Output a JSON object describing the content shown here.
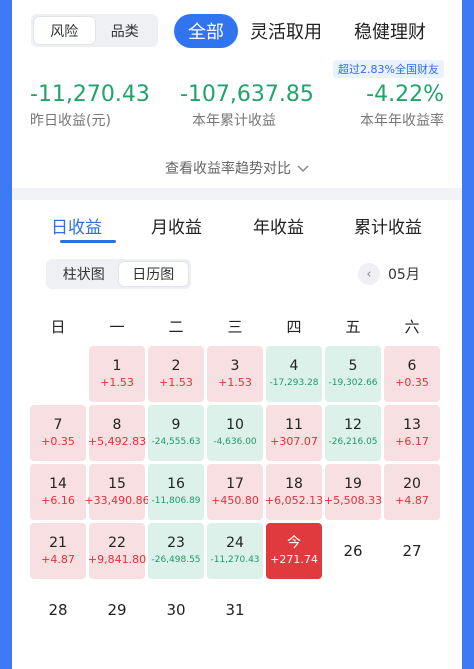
{
  "header": {
    "segment": [
      "风险",
      "品类"
    ],
    "tabs": [
      "全部",
      "灵活取用",
      "稳健理财"
    ],
    "badge": "超过2.83%全国财友"
  },
  "stats": [
    {
      "value": "-11,270.43",
      "label": "昨日收益(元)"
    },
    {
      "value": "-107,637.85",
      "label": "本年累计收益"
    },
    {
      "value": "-4.22%",
      "label": "本年年收益率"
    }
  ],
  "trend_link": "查看收益率趋势对比",
  "sub_tabs": [
    "日收益",
    "月收益",
    "年收益",
    "累计收益"
  ],
  "view_toggle": [
    "柱状图",
    "日历图"
  ],
  "month": "05月",
  "weekdays": [
    "日",
    "一",
    "二",
    "三",
    "四",
    "五",
    "六"
  ],
  "calendar": [
    {
      "day": "1",
      "value": "+1.53"
    },
    {
      "day": "2",
      "value": "+1.53"
    },
    {
      "day": "3",
      "value": "+1.53"
    },
    {
      "day": "4",
      "value": "-17,293.28"
    },
    {
      "day": "5",
      "value": "-19,302.66"
    },
    {
      "day": "6",
      "value": "+0.35"
    },
    {
      "day": "7",
      "value": "+0.35"
    },
    {
      "day": "8",
      "value": "+5,492.83"
    },
    {
      "day": "9",
      "value": "-24,555.63"
    },
    {
      "day": "10",
      "value": "-4,636.00"
    },
    {
      "day": "11",
      "value": "+307.07"
    },
    {
      "day": "12",
      "value": "-26,216.05"
    },
    {
      "day": "13",
      "value": "+6.17"
    },
    {
      "day": "14",
      "value": "+6.16"
    },
    {
      "day": "15",
      "value": "+33,490.86"
    },
    {
      "day": "16",
      "value": "-11,806.89"
    },
    {
      "day": "17",
      "value": "+450.80"
    },
    {
      "day": "18",
      "value": "+6,052.13"
    },
    {
      "day": "19",
      "value": "+5,508.33"
    },
    {
      "day": "20",
      "value": "+4.87"
    },
    {
      "day": "21",
      "value": "+4.87"
    },
    {
      "day": "22",
      "value": "+9,841.80"
    },
    {
      "day": "23",
      "value": "-26,498.55"
    },
    {
      "day": "24",
      "value": "-11,270.43"
    },
    {
      "day": "今",
      "value": "+271.74"
    },
    {
      "day": "26",
      "value": ""
    },
    {
      "day": "27",
      "value": ""
    },
    {
      "day": "28",
      "value": ""
    },
    {
      "day": "29",
      "value": ""
    },
    {
      "day": "30",
      "value": ""
    },
    {
      "day": "31",
      "value": ""
    }
  ],
  "colors": {
    "accent": "#3174f0",
    "positive": "#e0323a",
    "negative": "#1f9a68",
    "stat_value": "#22a36b"
  }
}
